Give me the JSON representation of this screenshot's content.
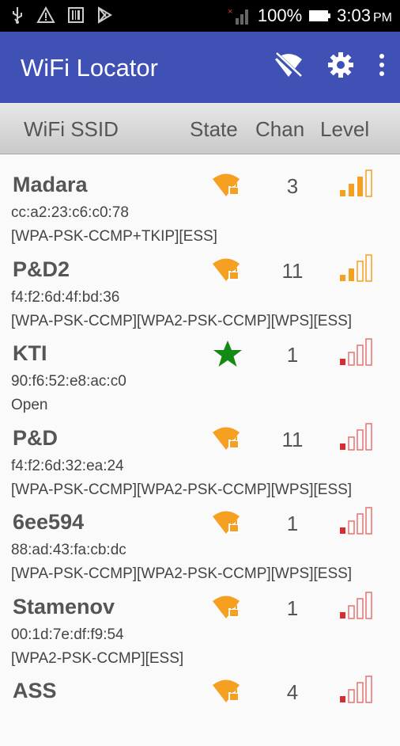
{
  "status_bar": {
    "battery_percent": "100%",
    "time": "3:03",
    "time_suffix": "PM",
    "icons": [
      "usb-icon",
      "warning-icon",
      "barcode-icon",
      "play-store-icon",
      "no-signal-icon",
      "battery-icon"
    ]
  },
  "appbar": {
    "title": "WiFi Locator",
    "actions": [
      "wifi-off-icon",
      "settings-icon",
      "more-vert-icon"
    ],
    "color": "#3f51b5"
  },
  "columns": {
    "ssid": "WiFi SSID",
    "state": "State",
    "chan": "Chan",
    "level": "Level"
  },
  "networks": [
    {
      "ssid": "Madara",
      "mac": "cc:a2:23:c6:c0:78",
      "caps": "[WPA-PSK-CCMP+TKIP][ESS]",
      "channel": "3",
      "state": "locked",
      "level": 3
    },
    {
      "ssid": "P&D2",
      "mac": "f4:f2:6d:4f:bd:36",
      "caps": "[WPA-PSK-CCMP][WPA2-PSK-CCMP][WPS][ESS]",
      "channel": "11",
      "state": "locked",
      "level": 2
    },
    {
      "ssid": "KTI",
      "mac": "90:f6:52:e8:ac:c0",
      "caps": "Open",
      "channel": "1",
      "state": "open",
      "level": 1
    },
    {
      "ssid": "P&D",
      "mac": "f4:f2:6d:32:ea:24",
      "caps": "[WPA-PSK-CCMP][WPA2-PSK-CCMP][WPS][ESS]",
      "channel": "11",
      "state": "locked",
      "level": 1
    },
    {
      "ssid": "6ee594",
      "mac": "88:ad:43:fa:cb:dc",
      "caps": "[WPA-PSK-CCMP][WPA2-PSK-CCMP][WPS][ESS]",
      "channel": "1",
      "state": "locked",
      "level": 1
    },
    {
      "ssid": "Stamenov",
      "mac": "00:1d:7e:df:f9:54",
      "caps": "[WPA2-PSK-CCMP][ESS]",
      "channel": "1",
      "state": "locked",
      "level": 1
    },
    {
      "ssid": "ASS",
      "mac": "",
      "caps": "",
      "channel": "4",
      "state": "locked",
      "level": 1
    }
  ],
  "colors": {
    "lock_orange": "#f5a020",
    "level_high": "#f5a020",
    "level_low": "#d32f2f",
    "open_star": "#138a13"
  }
}
